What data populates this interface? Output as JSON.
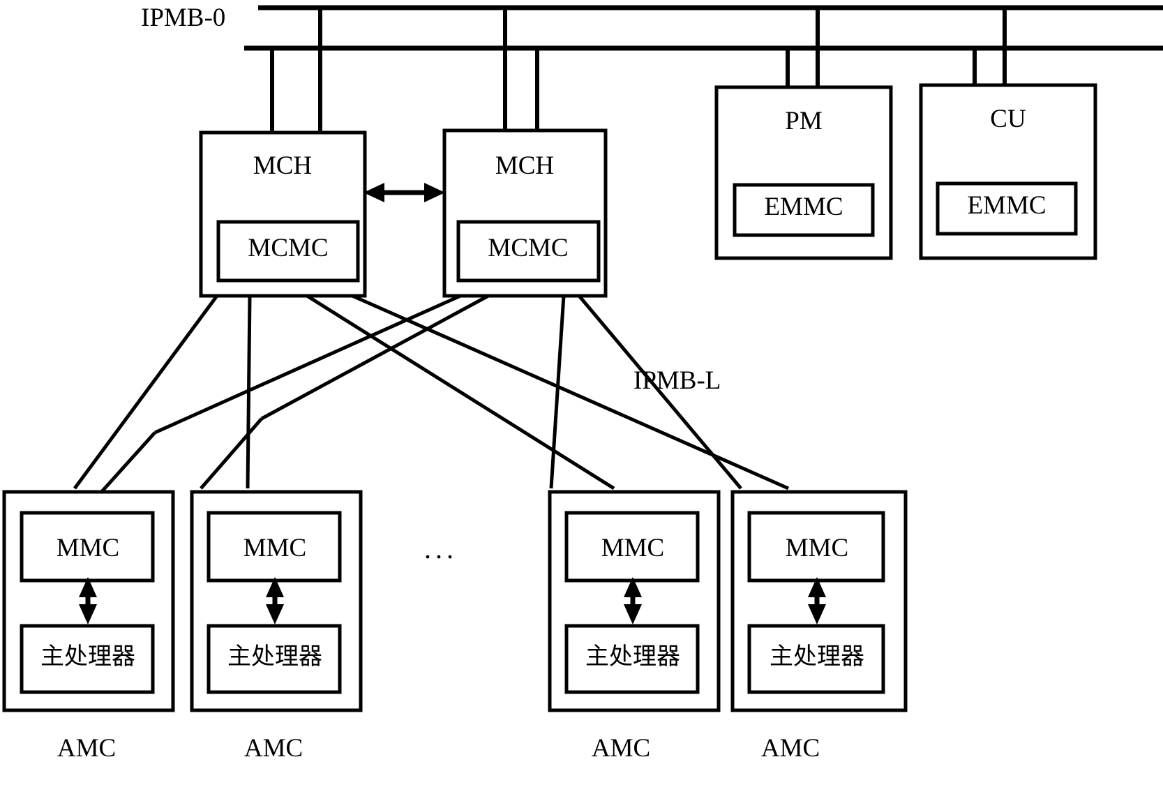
{
  "diagram": {
    "title_labels": {
      "ipmb0": "IPMB-0",
      "ipmbl": "IPMB-L"
    },
    "ellipsis": "...",
    "top_units": [
      {
        "name": "MCH",
        "inner": "MCMC"
      },
      {
        "name": "MCH",
        "inner": "MCMC"
      },
      {
        "name": "PM",
        "inner": "EMMC"
      },
      {
        "name": "CU",
        "inner": "EMMC"
      }
    ],
    "amc_units": [
      {
        "caption": "AMC",
        "mmc": "MMC",
        "cpu": "主处理器"
      },
      {
        "caption": "AMC",
        "mmc": "MMC",
        "cpu": "主处理器"
      },
      {
        "caption": "AMC",
        "mmc": "MMC",
        "cpu": "主处理器"
      },
      {
        "caption": "AMC",
        "mmc": "MMC",
        "cpu": "主处理器"
      }
    ],
    "colors": {
      "stroke": "#000000",
      "background": "#ffffff"
    }
  }
}
